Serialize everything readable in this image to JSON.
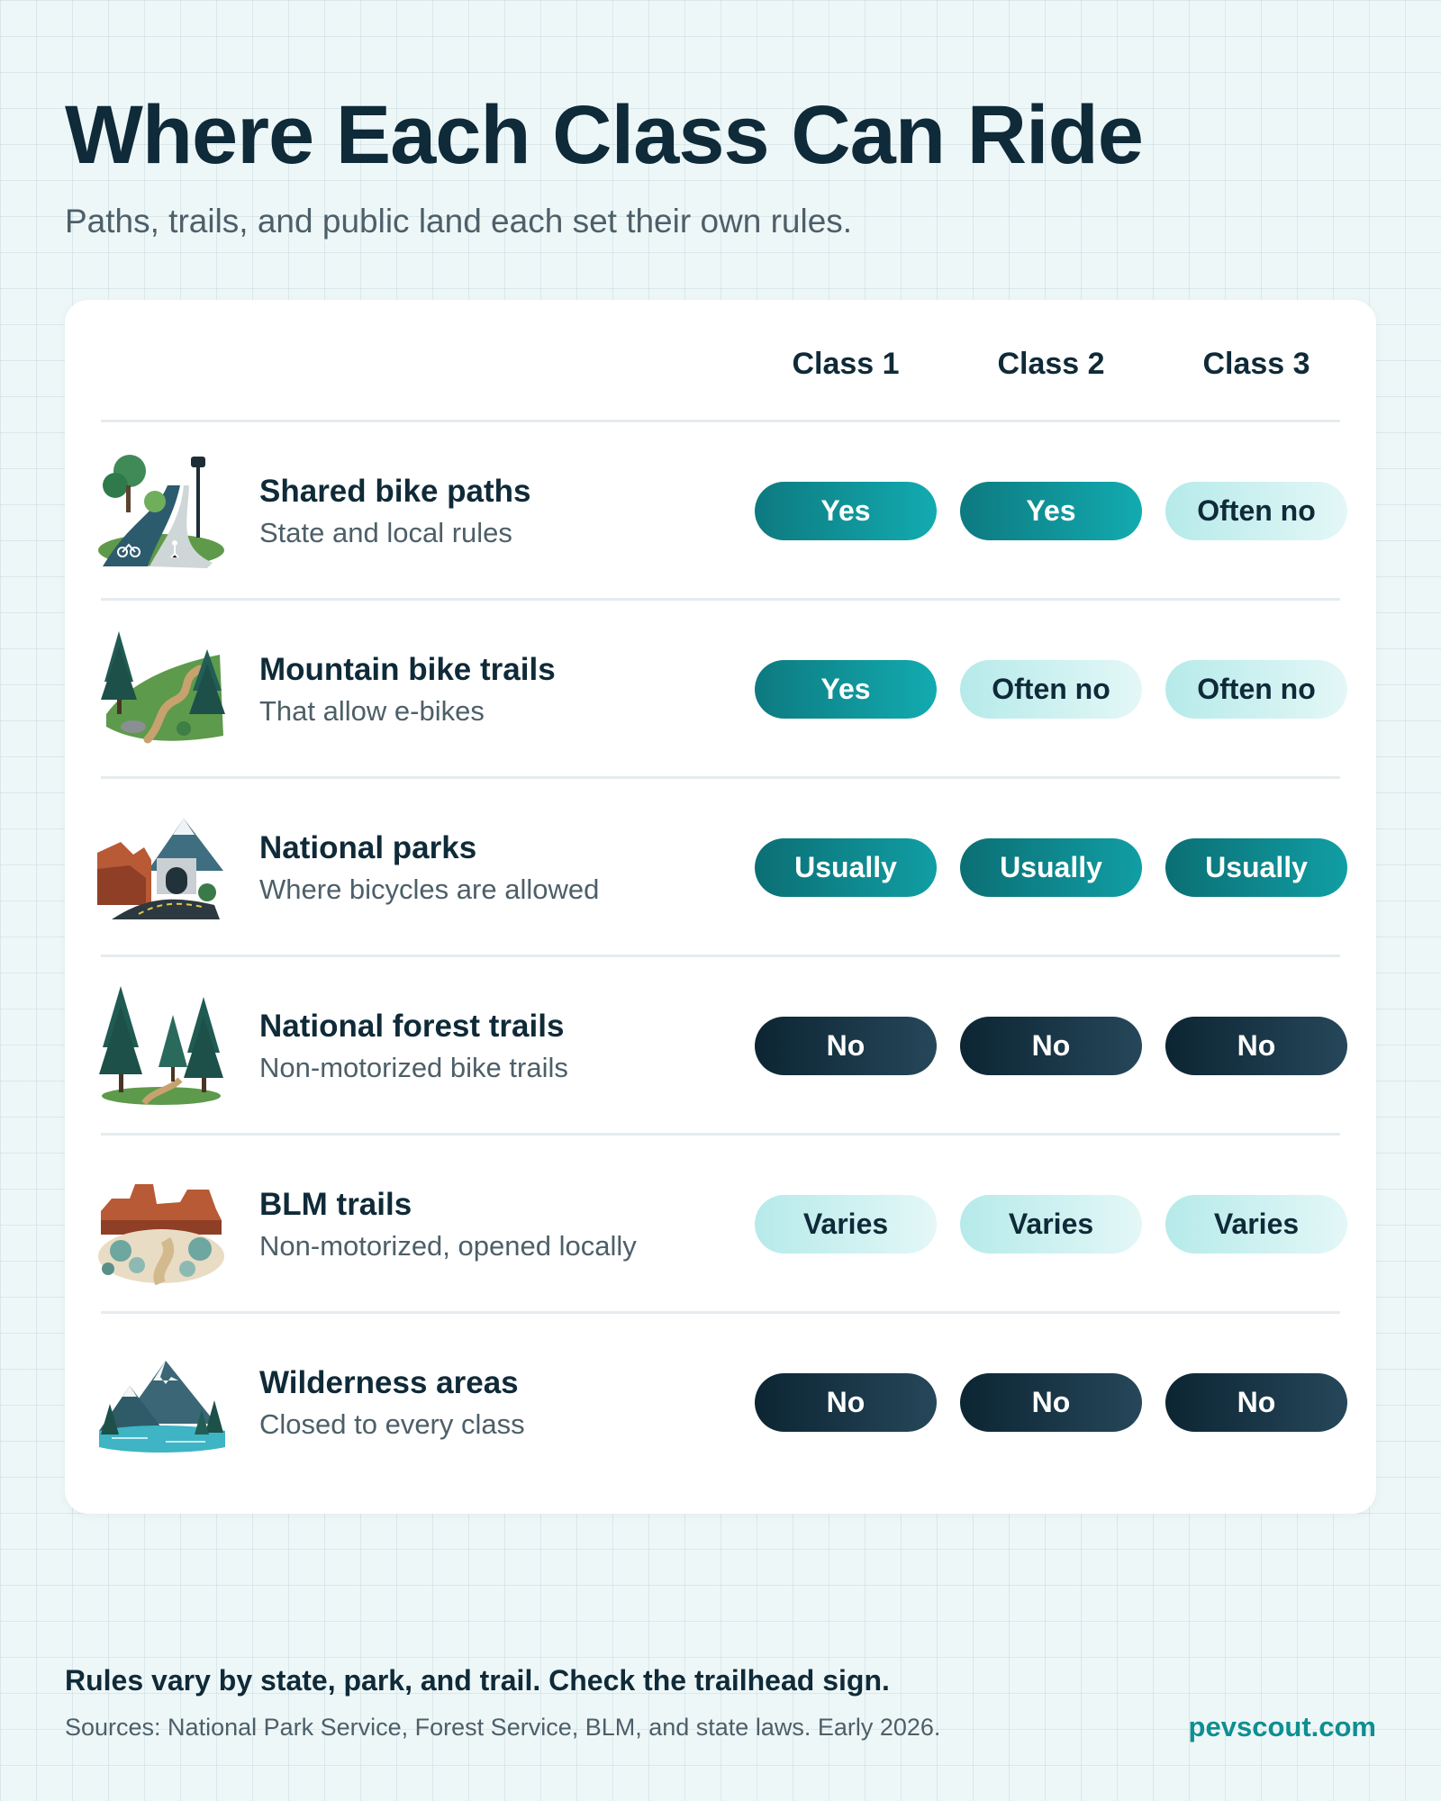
{
  "title": "Where Each Class Can Ride",
  "subtitle": "Paths, trails, and public land each set their own rules.",
  "columns": [
    "Class 1",
    "Class 2",
    "Class 3"
  ],
  "rows": [
    {
      "name": "Shared bike paths",
      "desc": "State and local rules",
      "icon": "bike-path-icon",
      "values": [
        "Yes",
        "Yes",
        "Often no"
      ]
    },
    {
      "name": "Mountain bike trails",
      "desc": "That allow e-bikes",
      "icon": "mountain-trail-icon",
      "values": [
        "Yes",
        "Often no",
        "Often no"
      ]
    },
    {
      "name": "National parks",
      "desc": "Where bicycles are allowed",
      "icon": "national-park-icon",
      "values": [
        "Usually",
        "Usually",
        "Usually"
      ]
    },
    {
      "name": "National forest trails",
      "desc": "Non-motorized bike trails",
      "icon": "forest-icon",
      "values": [
        "No",
        "No",
        "No"
      ]
    },
    {
      "name": "BLM trails",
      "desc": "Non-motorized, opened locally",
      "icon": "desert-trail-icon",
      "values": [
        "Varies",
        "Varies",
        "Varies"
      ]
    },
    {
      "name": "Wilderness areas",
      "desc": "Closed to every class",
      "icon": "wilderness-icon",
      "values": [
        "No",
        "No",
        "No"
      ]
    }
  ],
  "footer": {
    "note": "Rules vary by state, park, and trail. Check the trailhead sign.",
    "sources": "Sources: National Park Service, Forest Service, BLM, and state laws. Early 2026.",
    "brand": "pevscout.com"
  },
  "colors": {
    "yes": "#0e8f94",
    "usually": "#0b7b80",
    "no": "#122f3f",
    "soft": "#c4eeee",
    "brand": "#0e8f92"
  }
}
